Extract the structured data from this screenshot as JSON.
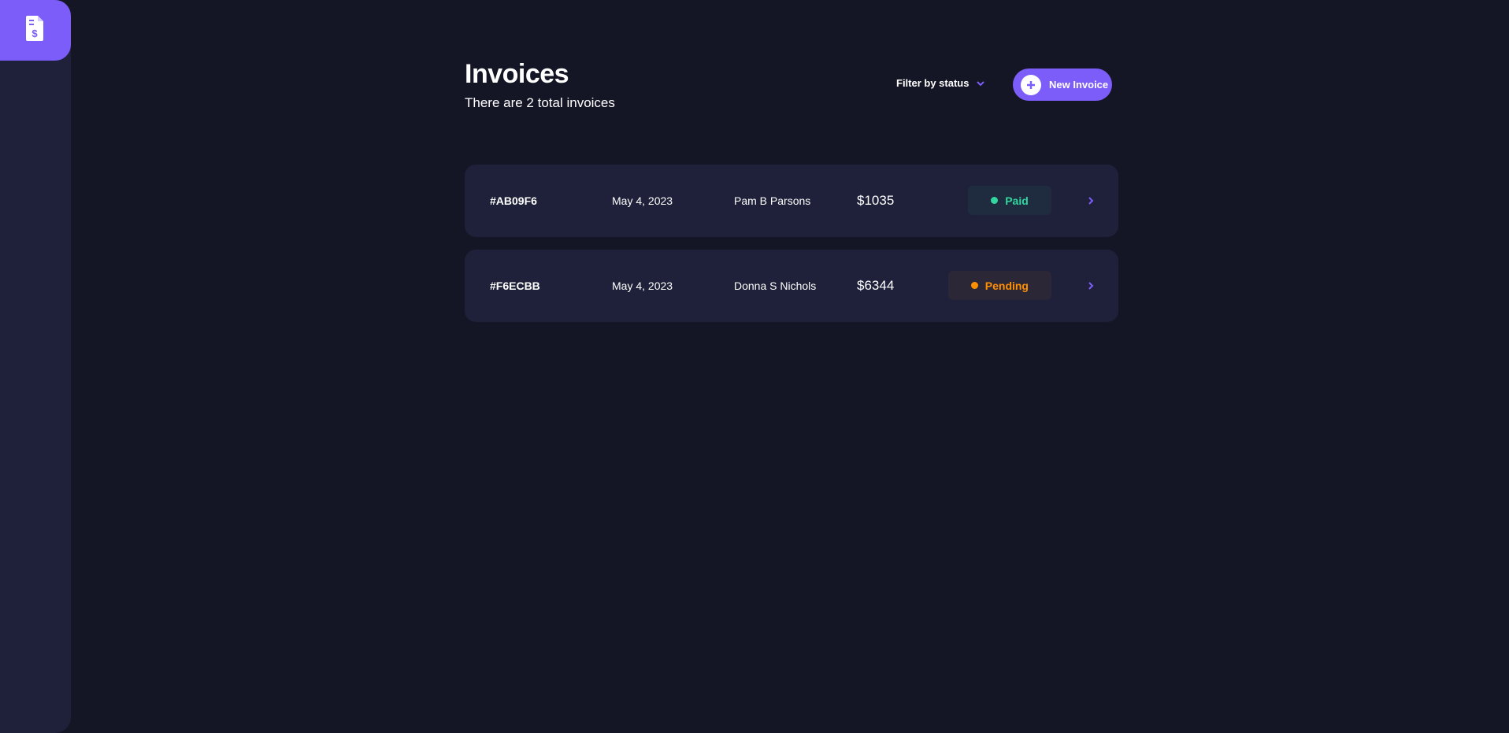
{
  "colors": {
    "background": "#141625",
    "sidebar": "#1e2139",
    "accent": "#7c5dfa",
    "card": "#1e2139",
    "paid": "#33d69f",
    "pending": "#ff8f00"
  },
  "sidebar": {
    "logo_icon": "invoice-dollar-icon"
  },
  "header": {
    "title": "Invoices",
    "subtitle": "There are 2 total invoices",
    "filter_label": "Filter by status",
    "filter_icon": "chevron-down-icon",
    "new_invoice_label": "New Invoice",
    "new_invoice_icon": "plus-icon"
  },
  "invoices": [
    {
      "id": "#AB09F6",
      "date": "May 4, 2023",
      "client": "Pam B Parsons",
      "amount": "$1035",
      "status": "Paid",
      "status_key": "paid"
    },
    {
      "id": "#F6ECBB",
      "date": "May 4, 2023",
      "client": "Donna S Nichols",
      "amount": "$6344",
      "status": "Pending",
      "status_key": "pending"
    }
  ]
}
